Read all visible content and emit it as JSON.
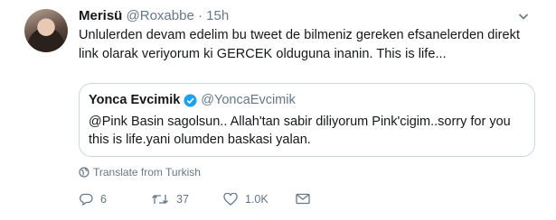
{
  "tweet": {
    "display_name": "Merisü",
    "handle": "@Roxabbe",
    "separator": "·",
    "time": "15h",
    "text": "Unlulerden devam edelim bu tweet de bilmeniz gereken efsanelerden direkt link olarak veriyorum ki GERCEK olduguna inanin. This is life..."
  },
  "quoted": {
    "display_name": "Yonca Evcimik",
    "handle": "@YoncaEvcimik",
    "verified": true,
    "text": "@Pink Basin sagolsun.. Allah'tan sabir diliyorum Pink'cigim..sorry for you this is life.yani olumden baskasi yalan."
  },
  "translate_label": "Translate from Turkish",
  "actions": {
    "reply_count": "6",
    "retweet_count": "37",
    "like_count": "1.0K"
  },
  "icons": [
    "avatar",
    "chevron-down-icon",
    "verified-badge-icon",
    "globe-icon",
    "reply-icon",
    "retweet-icon",
    "like-icon",
    "direct-message-icon"
  ],
  "colors": {
    "text": "#14171a",
    "muted": "#657786",
    "verified": "#1da1f2",
    "border": "#ccd6dd"
  }
}
